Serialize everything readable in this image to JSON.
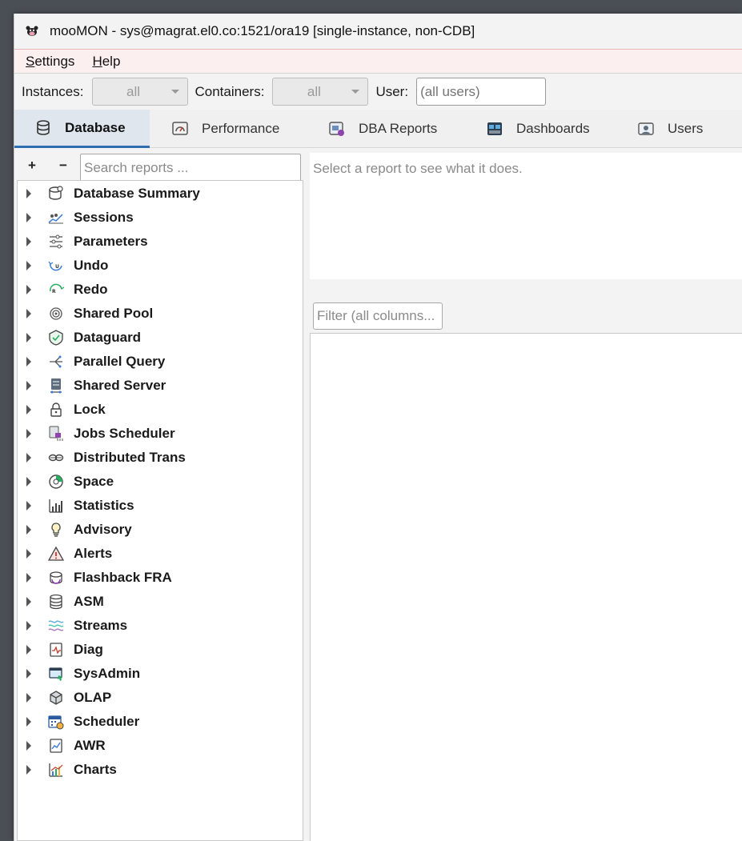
{
  "window": {
    "title": "mooMON - sys@magrat.el0.co:1521/ora19  [single-instance, non-CDB]"
  },
  "menu": {
    "items": [
      {
        "first": "S",
        "rest": "ettings"
      },
      {
        "first": "H",
        "rest": "elp"
      }
    ]
  },
  "filters": {
    "instances_label": "Instances:",
    "instances_value": "all",
    "containers_label": "Containers:",
    "containers_value": "all",
    "user_label": "User:",
    "user_placeholder": "(all users)"
  },
  "tabs": [
    {
      "label": "Database",
      "icon": "database-icon",
      "active": true
    },
    {
      "label": "Performance",
      "icon": "performance-icon",
      "active": false
    },
    {
      "label": "DBA Reports",
      "icon": "dba-reports-icon",
      "active": false
    },
    {
      "label": "Dashboards",
      "icon": "dashboards-icon",
      "active": false
    },
    {
      "label": "Users",
      "icon": "users-icon",
      "active": false
    }
  ],
  "left_toolbar": {
    "expand_label": "+",
    "collapse_label": "−",
    "search_placeholder": "Search reports ..."
  },
  "tree": {
    "items": [
      {
        "label": "Database Summary",
        "icon": "database-summary-icon"
      },
      {
        "label": "Sessions",
        "icon": "sessions-icon"
      },
      {
        "label": "Parameters",
        "icon": "parameters-icon"
      },
      {
        "label": "Undo",
        "icon": "undo-icon"
      },
      {
        "label": "Redo",
        "icon": "redo-icon"
      },
      {
        "label": "Shared Pool",
        "icon": "shared-pool-icon"
      },
      {
        "label": "Dataguard",
        "icon": "dataguard-icon"
      },
      {
        "label": "Parallel Query",
        "icon": "parallel-query-icon"
      },
      {
        "label": "Shared Server",
        "icon": "shared-server-icon"
      },
      {
        "label": "Lock",
        "icon": "lock-icon"
      },
      {
        "label": "Jobs Scheduler",
        "icon": "jobs-scheduler-icon"
      },
      {
        "label": "Distributed Trans",
        "icon": "distributed-trans-icon"
      },
      {
        "label": "Space",
        "icon": "space-icon"
      },
      {
        "label": "Statistics",
        "icon": "statistics-icon"
      },
      {
        "label": "Advisory",
        "icon": "advisory-icon"
      },
      {
        "label": "Alerts",
        "icon": "alerts-icon"
      },
      {
        "label": "Flashback FRA",
        "icon": "flashback-fra-icon"
      },
      {
        "label": "ASM",
        "icon": "asm-icon"
      },
      {
        "label": "Streams",
        "icon": "streams-icon"
      },
      {
        "label": "Diag",
        "icon": "diag-icon"
      },
      {
        "label": "SysAdmin",
        "icon": "sysadmin-icon"
      },
      {
        "label": "OLAP",
        "icon": "olap-icon"
      },
      {
        "label": "Scheduler",
        "icon": "scheduler-icon"
      },
      {
        "label": "AWR",
        "icon": "awr-icon"
      },
      {
        "label": "Charts",
        "icon": "charts-icon"
      }
    ]
  },
  "right": {
    "description_placeholder": "Select a report to see what it does.",
    "filter_placeholder": "Filter (all columns..."
  },
  "colors": {
    "accent": "#2f6db3",
    "menubar_bg": "#fbeff0"
  }
}
